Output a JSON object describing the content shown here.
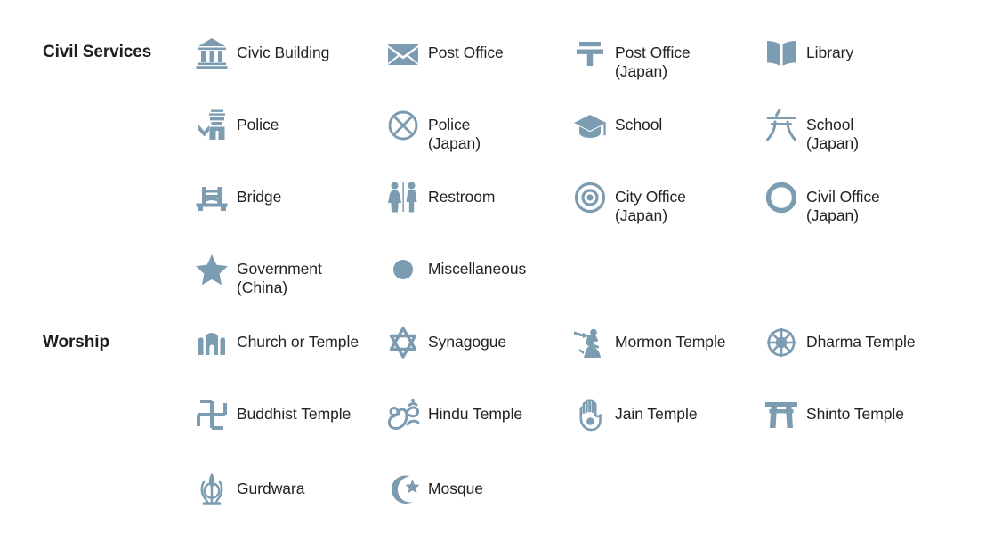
{
  "theme": {
    "icon_color": "#7b9cb1",
    "text_color": "#232323",
    "heading_color": "#1d1d1d",
    "background": "#ffffff"
  },
  "sections": [
    {
      "title": "Civil Services",
      "rows": [
        [
          {
            "icon": "civic-building-icon",
            "label": "Civic Building"
          },
          {
            "icon": "post-office-envelope-icon",
            "label": "Post Office"
          },
          {
            "icon": "post-office-japan-icon",
            "label": "Post Office\n(Japan)"
          },
          {
            "icon": "library-book-icon",
            "label": "Library"
          }
        ],
        [
          {
            "icon": "police-officer-icon",
            "label": "Police"
          },
          {
            "icon": "police-japan-icon",
            "label": "Police\n(Japan)"
          },
          {
            "icon": "school-graduation-cap-icon",
            "label": "School"
          },
          {
            "icon": "school-japan-icon",
            "label": "School\n(Japan)"
          }
        ],
        [
          {
            "icon": "bridge-icon",
            "label": "Bridge"
          },
          {
            "icon": "restroom-icon",
            "label": "Restroom"
          },
          {
            "icon": "city-office-japan-icon",
            "label": "City Office\n(Japan)"
          },
          {
            "icon": "civil-office-japan-icon",
            "label": "Civil Office\n(Japan)"
          }
        ],
        [
          {
            "icon": "government-china-star-icon",
            "label": "Government\n(China)"
          },
          {
            "icon": "miscellaneous-dot-icon",
            "label": "Miscellaneous"
          }
        ]
      ]
    },
    {
      "title": "Worship",
      "rows": [
        [
          {
            "icon": "church-or-temple-icon",
            "label": "Church or Temple"
          },
          {
            "icon": "synagogue-star-of-david-icon",
            "label": "Synagogue"
          },
          {
            "icon": "mormon-temple-angel-moroni-icon",
            "label": "Mormon Temple"
          },
          {
            "icon": "dharma-wheel-icon",
            "label": "Dharma Temple"
          }
        ],
        [
          {
            "icon": "buddhist-temple-manji-icon",
            "label": "Buddhist Temple"
          },
          {
            "icon": "hindu-temple-om-icon",
            "label": "Hindu Temple"
          },
          {
            "icon": "jain-temple-ahimsa-hand-icon",
            "label": "Jain Temple"
          },
          {
            "icon": "shinto-temple-torii-icon",
            "label": "Shinto Temple"
          }
        ],
        [
          {
            "icon": "gurdwara-khanda-icon",
            "label": "Gurdwara"
          },
          {
            "icon": "mosque-star-crescent-icon",
            "label": "Mosque"
          }
        ]
      ]
    }
  ]
}
